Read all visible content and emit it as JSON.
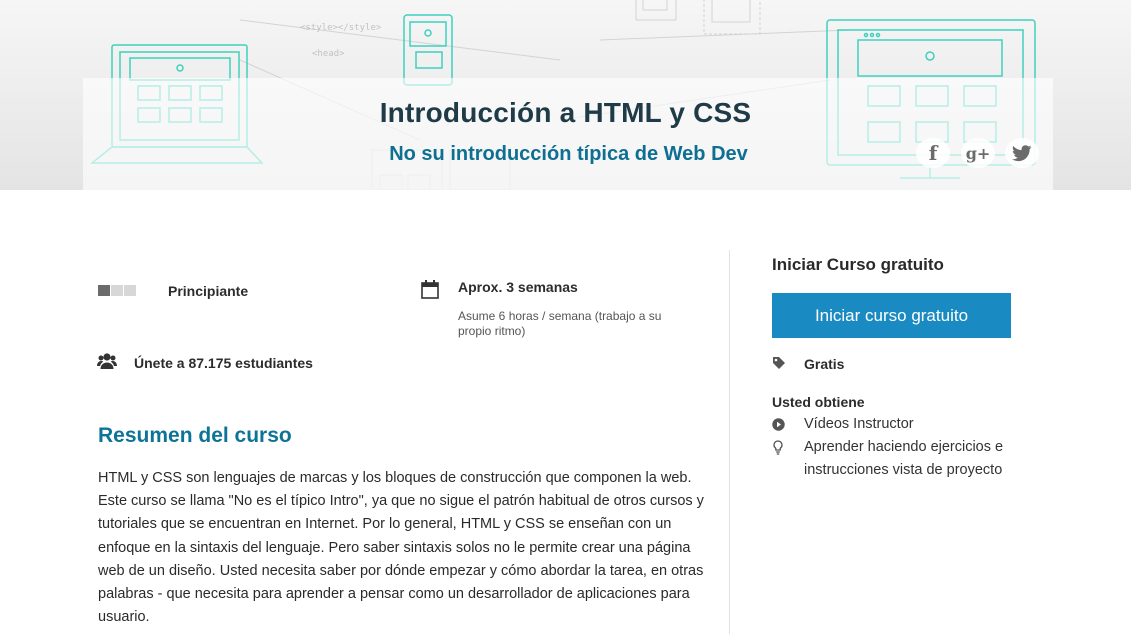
{
  "hero": {
    "title": "Introducción a HTML y CSS",
    "subtitle": "No su introducción típica de Web Dev",
    "illustration_code_labels": [
      "<style></style>",
      "<head>"
    ],
    "social": [
      {
        "name": "facebook-icon",
        "glyph": "f"
      },
      {
        "name": "google-plus-icon",
        "glyph": "g+"
      },
      {
        "name": "twitter-icon",
        "glyph": "bird"
      }
    ]
  },
  "course_info": {
    "level": "Principiante",
    "duration": "Aprox. 3 semanas",
    "duration_note": "Asume 6 horas / semana (trabajo a su propio ritmo)",
    "students": "Únete a 87.175 estudiantes"
  },
  "summary": {
    "title": "Resumen del curso",
    "text": "HTML y CSS son lenguajes de marcas y los bloques de construcción que componen la web. Este curso se llama \"No es el típico Intro\", ya que no sigue el patrón habitual de otros cursos y tutoriales que se encuentran en Internet. Por lo general, HTML y CSS se enseñan con un enfoque en la sintaxis del lenguaje. Pero saber sintaxis solos no le permite crear una página web de un diseño. Usted necesita saber por dónde empezar y cómo abordar la tarea, en otras palabras - que necesita para aprender a pensar como un desarrollador de aplicaciones para usuario."
  },
  "sidebar": {
    "title": "Iniciar Curso gratuito",
    "button_label": "Iniciar curso gratuito",
    "price": "Gratis",
    "gets_title": "Usted obtiene",
    "features": [
      {
        "icon": "play-icon",
        "label": "Vídeos Instructor"
      },
      {
        "icon": "lightbulb-icon",
        "label": "Aprender haciendo ejercicios e instrucciones vista de proyecto"
      }
    ]
  },
  "colors": {
    "accent": "#1a8bc2",
    "heading_blue": "#0e7497",
    "illustration_teal": "#3fd1bd",
    "hero_title": "#1f3b47"
  }
}
